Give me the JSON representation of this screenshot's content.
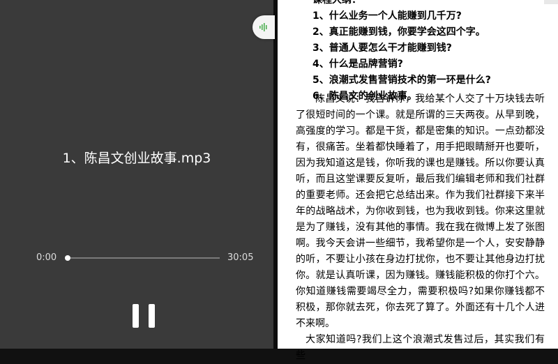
{
  "player": {
    "track_title": "1、陈昌文创业故事.mp3",
    "current_time": "0:00",
    "total_time": "30:05",
    "progress_fraction": 0.0,
    "float_icon": "audio-wave-icon",
    "pause_icon": "pause-icon",
    "accent_color": "#4caf50"
  },
  "document": {
    "outline_header": "课程大纲：",
    "outline_items": [
      "1、什么业务一个人能赚到几千万?",
      "2、真正能赚到钱，你要学会这四个字。",
      "3、普通人要怎么干才能赚到钱?",
      "4、什么是品牌营销?",
      "5、浪潮式发售营销技术的第一环是什么?",
      "6、陈昌文的创业故事。"
    ],
    "paragraph_1": "陈昌文说：我告诉你，我给某个人交了十万块钱去听了很短时间的一个课。就是所谓的三天两夜。从早到晚，高强度的学习。都是干货，都是密集的知识。一点劲都没有，很痛苦。坐着都快睡着了，用手把眼睛掰开也要听，因为我知道这是钱，你听我的课也是赚钱。所以你要认真听，而且这堂课要反复听，最后我们编辑老师和我们社群的重要老师。还会把它总结出来。作为我们社群接下来半年的战略战术，为你收到钱，也为我收到钱。你来这里就是为了赚钱，没有其他的事情。我在我在微博上发了张图啊。我今天会讲一些细节，我希望你是一个人，安安静静的听，不要让小孩在身边打扰你，也不要让其他身边打扰你。就是认真听课，因为赚钱。赚钱能积极的你打个六。你知道赚钱需要竭尽全力，需要积极吗?如果你赚钱都不积极，那你就去死，你去死了算了。外面还有十几个人进不来啊。",
    "paragraph_2": "大家知道吗?我们上这个浪潮式发售过后，其实我们有些"
  }
}
